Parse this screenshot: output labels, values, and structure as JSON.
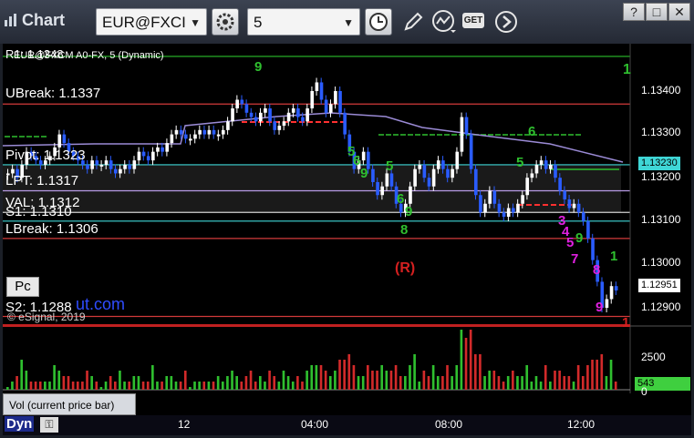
{
  "window": {
    "title": "Chart",
    "minimize": "?",
    "restore": "□",
    "close": "✕"
  },
  "toolbar": {
    "symbol": "EUR@FXCI",
    "interval": "5",
    "icons": [
      "gear-icon",
      "clock-icon",
      "pencil-icon",
      "indicator-icon",
      "get-icon",
      "next-icon"
    ],
    "get_label": "GET"
  },
  "chart": {
    "header": "EUR@FXCM A0-FX, 5 (Dynamic)",
    "r1_label": "R1: 1.1348",
    "copyright": "© eSignal, 2019",
    "watermark": "ut.com",
    "pc_button": "Pc",
    "reversal_marker": "(R)",
    "price_axis": {
      "ticks": [
        "1.13400",
        "1.13300",
        "1.13200",
        "1.13100",
        "1.13000",
        "1.12900"
      ]
    },
    "current_price_tag": "1.13230",
    "last_price_tag": "1.12951",
    "volume_axis": {
      "ticks": [
        "2500",
        "0"
      ],
      "last_volume": "543"
    },
    "time_axis": [
      "12",
      "04:00",
      "08:00",
      "12:00"
    ],
    "levels": [
      {
        "name": "r1",
        "label": "",
        "price": 1.1348,
        "color": "#2bbf2b",
        "dash": false
      },
      {
        "name": "upper-break",
        "label": "UBreak: 1.1337",
        "price": 1.1337,
        "color": "#d23a3a",
        "dash": false
      },
      {
        "name": "pivot",
        "label": "Pivot: 1.1323",
        "price": 1.1323,
        "color": "#3fd6d6",
        "dash": false
      },
      {
        "name": "lpt",
        "label": "LPT: 1.1317",
        "price": 1.1317,
        "color": "#b89be6",
        "dash": false
      },
      {
        "name": "val",
        "label": "VAL: 1.1312",
        "price": 1.1312,
        "color": "#d0d0d0",
        "dash": false
      },
      {
        "name": "s1",
        "label": "S1: 1.1310",
        "price": 1.131,
        "color": "#3fd6d6",
        "dash": false
      },
      {
        "name": "lower-break",
        "label": "LBreak: 1.1306",
        "price": 1.1306,
        "color": "#d23a3a",
        "dash": false
      },
      {
        "name": "s2",
        "label": "S2: 1.1288",
        "price": 1.1288,
        "color": "#d23a3a",
        "dash": false
      }
    ],
    "green_sequence_numbers": [
      "9",
      "5",
      "6",
      "9",
      "5",
      "6",
      "9",
      "8",
      "5",
      "6",
      "9",
      "1"
    ],
    "magenta_sequence_numbers": [
      "3",
      "4",
      "5",
      "7",
      "8",
      "9"
    ],
    "red_sequence_numbers": [
      "1"
    ],
    "volume_tab": "Vol (current price bar)",
    "bottom_label": "Dyn"
  },
  "colors": {
    "bull_candle": "#ffffff",
    "bear_candle": "#2a5cff",
    "volume_up": "#2fbf2f",
    "volume_down": "#d22a2a",
    "poc_line": "#9b8bd6"
  }
}
